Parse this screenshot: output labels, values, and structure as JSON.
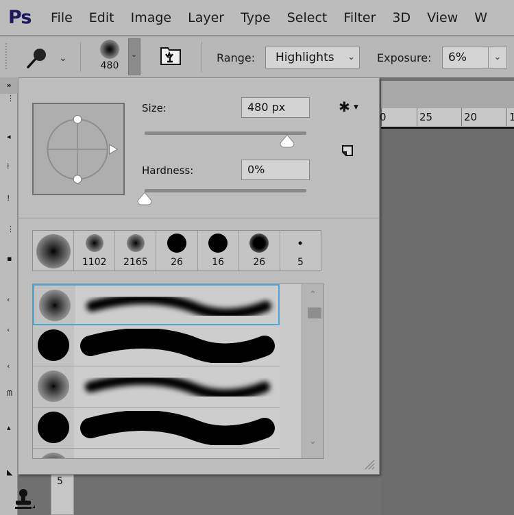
{
  "app": {
    "logo": "Ps",
    "menu": [
      "File",
      "Edit",
      "Image",
      "Layer",
      "Type",
      "Select",
      "Filter",
      "3D",
      "View",
      "W"
    ]
  },
  "options_bar": {
    "tool_icon": "dodge-tool-icon",
    "brush_size": "480",
    "range_label": "Range:",
    "range_value": "Highlights",
    "exposure_label": "Exposure:",
    "exposure_value": "6%"
  },
  "toolbar": {
    "collapse_glyph": "»",
    "ruler_number": "5"
  },
  "ruler": {
    "labels": [
      "0",
      "25",
      "20",
      "1"
    ]
  },
  "brush_panel": {
    "size_label": "Size:",
    "size_value": "480 px",
    "size_fraction": 0.88,
    "hardness_label": "Hardness:",
    "hardness_value": "0%",
    "hardness_fraction": 0.0,
    "gear_glyph": "✱",
    "recent_brushes": [
      {
        "label": "",
        "type": "soft"
      },
      {
        "label": "1102",
        "type": "soft"
      },
      {
        "label": "2165",
        "type": "soft"
      },
      {
        "label": "26",
        "type": "hard"
      },
      {
        "label": "16",
        "type": "hard"
      },
      {
        "label": "26",
        "type": "soft-dark"
      },
      {
        "label": "5",
        "type": "tiny"
      }
    ],
    "presets": [
      {
        "type": "soft",
        "selected": true
      },
      {
        "type": "hard",
        "selected": false
      },
      {
        "type": "soft",
        "selected": false
      },
      {
        "type": "hard",
        "selected": false
      },
      {
        "type": "soft",
        "selected": false
      }
    ],
    "scroll_up": "^",
    "scroll_down": "v"
  },
  "colors": {
    "selection": "#4aa8d8",
    "logo": "#1c1a5c"
  }
}
